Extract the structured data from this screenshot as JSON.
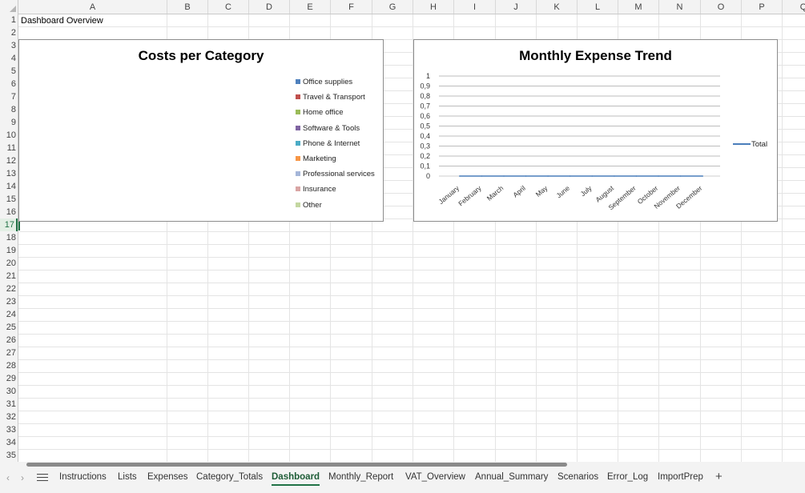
{
  "columns": [
    "A",
    "B",
    "C",
    "D",
    "E",
    "F",
    "G",
    "H",
    "I",
    "J",
    "K",
    "L",
    "M",
    "N",
    "O",
    "P",
    "Q"
  ],
  "rows": [
    "1",
    "2",
    "3",
    "4",
    "5",
    "6",
    "7",
    "8",
    "9",
    "10",
    "11",
    "12",
    "13",
    "14",
    "15",
    "16",
    "17",
    "18",
    "19",
    "20",
    "21",
    "22",
    "23",
    "24",
    "25",
    "26",
    "27",
    "28",
    "29",
    "30",
    "31",
    "32",
    "33",
    "34",
    "35"
  ],
  "active_row": "17",
  "cell_a1": "Dashboard Overview",
  "chart_data": [
    {
      "type": "pie",
      "title": "Costs per Category",
      "categories": [
        "Office supplies",
        "Travel & Transport",
        "Home office",
        "Software & Tools",
        "Phone & Internet",
        "Marketing",
        "Professional services",
        "Insurance",
        "Other"
      ],
      "values": [],
      "colors": [
        "#4f81bd",
        "#c0504d",
        "#9bbb59",
        "#8064a2",
        "#4bacc6",
        "#f79646",
        "#a5b6d9",
        "#d9a5a4",
        "#c4d7a1"
      ],
      "legend_position": "right"
    },
    {
      "type": "line",
      "title": "Monthly Expense Trend",
      "categories": [
        "January",
        "February",
        "March",
        "April",
        "May",
        "June",
        "July",
        "August",
        "September",
        "October",
        "November",
        "December"
      ],
      "yticks": [
        "1",
        "0,9",
        "0,8",
        "0,7",
        "0,6",
        "0,5",
        "0,4",
        "0,3",
        "0,2",
        "0,1",
        "0"
      ],
      "ylim": [
        0,
        1
      ],
      "series": [
        {
          "name": "Total",
          "values": [
            0,
            0,
            0,
            0,
            0,
            0,
            0,
            0,
            0,
            0,
            0,
            0
          ]
        }
      ],
      "series_color": "#4a7ebb",
      "legend_position": "right",
      "grid": true
    }
  ],
  "tabs": [
    "Instructions",
    "Lists",
    "Expenses",
    "Category_Totals",
    "Dashboard",
    "Monthly_Report",
    "VAT_Overview",
    "Annual_Summary",
    "Scenarios",
    "Error_Log",
    "ImportPrep"
  ],
  "active_tab": "Dashboard",
  "icons": {
    "prev": "chevron-left-icon",
    "next": "chevron-right-icon",
    "menu": "hamburger-icon",
    "add": "plus-icon"
  }
}
